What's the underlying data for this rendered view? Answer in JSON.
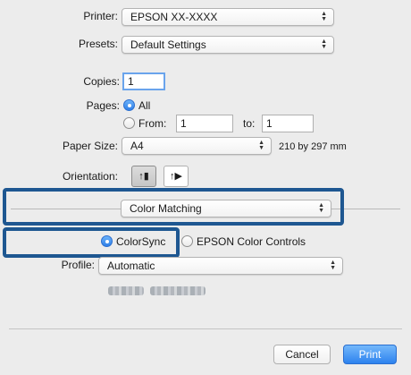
{
  "printer": {
    "label": "Printer:",
    "value": "EPSON XX-XXXX"
  },
  "presets": {
    "label": "Presets:",
    "value": "Default Settings"
  },
  "copies": {
    "label": "Copies:",
    "value": "1"
  },
  "pages": {
    "label": "Pages:",
    "all_label": "All",
    "from_label": "From:",
    "from_value": "1",
    "to_label": "to:",
    "to_value": "1"
  },
  "paper_size": {
    "label": "Paper Size:",
    "value": "A4",
    "dimensions": "210 by 297 mm"
  },
  "orientation": {
    "label": "Orientation:"
  },
  "panel": {
    "value": "Color Matching"
  },
  "color_mode": {
    "colorsync_label": "ColorSync",
    "epson_label": "EPSON Color Controls"
  },
  "profile": {
    "label": "Profile:",
    "value": "Automatic"
  },
  "buttons": {
    "cancel": "Cancel",
    "print": "Print"
  },
  "colors": {
    "highlight": "#1e5791",
    "accent": "#2d82ee"
  }
}
